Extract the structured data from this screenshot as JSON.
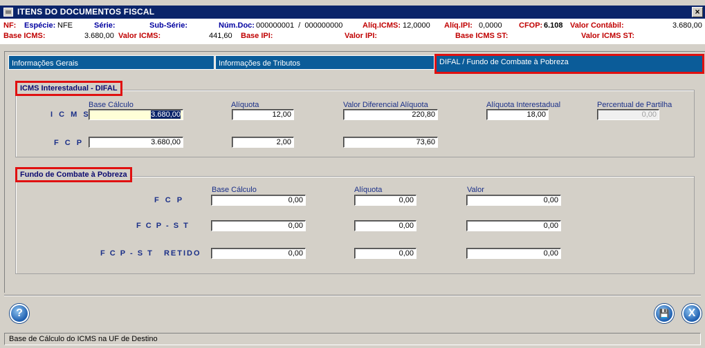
{
  "window": {
    "title": "ITENS DO DOCUMENTOS FISCAL",
    "close": "×"
  },
  "info": {
    "nf_label": "NF:",
    "especie_label": "Espécie:",
    "especie": "NFE",
    "serie_label": "Série:",
    "subserie_label": "Sub-Série:",
    "numdoc_label": "Núm.Doc:",
    "numdoc": "000000001  /  000000000",
    "aliq_icms_label": "Alíq.ICMS:",
    "aliq_icms": "12,0000",
    "aliq_ipi_label": "Alíq.IPI:",
    "aliq_ipi": "0,0000",
    "cfop_label": "CFOP:",
    "cfop": "6.108",
    "valor_contabil_label": "Valor Contábil:",
    "valor_contabil": "3.680,00",
    "base_icms_label": "Base ICMS:",
    "base_icms": "3.680,00",
    "valor_icms_label": "Valor ICMS:",
    "valor_icms": "441,60",
    "base_ipi_label": "Base IPI:",
    "valor_ipi_label": "Valor IPI:",
    "base_icms_st_label": "Base ICMS ST:",
    "valor_icms_st_label": "Valor ICMS ST:"
  },
  "tabs": [
    "Informações Gerais",
    "Informações de Tributos",
    "DIFAL / Fundo de Combate à Pobreza"
  ],
  "difal": {
    "title": "ICMS Interestadual - DIFAL",
    "cols": [
      "Base Cálculo",
      "Alíquota",
      "Valor Diferencial Alíquota",
      "Alíquota Interestadual",
      "Percentual de Partilha"
    ],
    "rows": [
      {
        "label": "I C M S",
        "base": "3.680,00",
        "aliquota": "12,00",
        "valor_dif": "220,80",
        "aliq_inter": "18,00",
        "partilha": "0,00"
      },
      {
        "label": "F C P",
        "base": "3.680,00",
        "aliquota": "2,00",
        "valor_dif": "73,60"
      }
    ]
  },
  "fcp": {
    "title": "Fundo de Combate à Pobreza",
    "cols": [
      "Base Cálculo",
      "Alíquota",
      "Valor"
    ],
    "rows": [
      {
        "label": "F C P",
        "base": "0,00",
        "aliquota": "0,00",
        "valor": "0,00"
      },
      {
        "label": "F C P - S T",
        "base": "0,00",
        "aliquota": "0,00",
        "valor": "0,00"
      },
      {
        "label": "F C P - S T   RETIDO",
        "base": "0,00",
        "aliquota": "0,00",
        "valor": "0,00"
      }
    ]
  },
  "buttons": {
    "help": "?",
    "save": "💾",
    "exit": "X"
  },
  "status": "Base de Cálculo do ICMS na UF de Destino"
}
